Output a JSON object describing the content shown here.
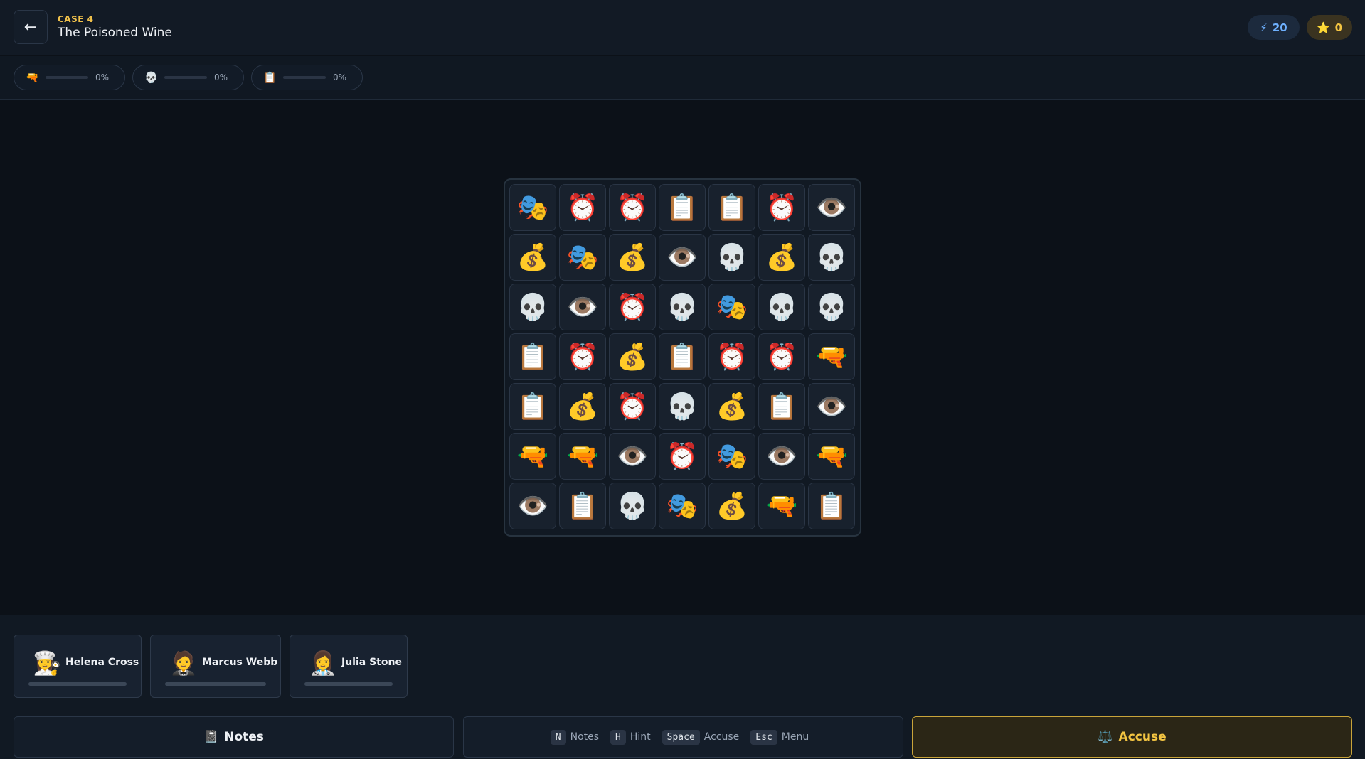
{
  "header": {
    "back_icon": "←",
    "case_label": "CASE 4",
    "title": "The Poisoned Wine",
    "energy": {
      "icon": "⚡",
      "value": "20"
    },
    "stars": {
      "icon": "⭐",
      "value": "0"
    }
  },
  "progress": [
    {
      "icon": "🔫",
      "percent": "0%"
    },
    {
      "icon": "💀",
      "percent": "0%"
    },
    {
      "icon": "📋",
      "percent": "0%"
    }
  ],
  "board": {
    "rows": [
      [
        "🎭",
        "⏰",
        "⏰",
        "📋",
        "📋",
        "⏰",
        "👁️"
      ],
      [
        "💰",
        "🎭",
        "💰",
        "👁️",
        "💀",
        "💰",
        "💀"
      ],
      [
        "💀",
        "👁️",
        "⏰",
        "💀",
        "🎭",
        "💀",
        "💀"
      ],
      [
        "📋",
        "⏰",
        "💰",
        "📋",
        "⏰",
        "⏰",
        "🔫"
      ],
      [
        "📋",
        "💰",
        "⏰",
        "💀",
        "💰",
        "📋",
        "👁️"
      ],
      [
        "🔫",
        "🔫",
        "👁️",
        "⏰",
        "🎭",
        "👁️",
        "🔫"
      ],
      [
        "👁️",
        "📋",
        "💀",
        "🎭",
        "💰",
        "🔫",
        "📋"
      ]
    ]
  },
  "suspects": [
    {
      "avatar": "👩‍🍳",
      "name": "Helena Cross"
    },
    {
      "avatar": "🤵",
      "name": "Marcus Webb"
    },
    {
      "avatar": "👩‍⚕️",
      "name": "Julia Stone"
    }
  ],
  "actions": {
    "notes_icon": "📓",
    "notes_label": "Notes",
    "accuse_icon": "⚖️",
    "accuse_label": "Accuse",
    "shortcuts": [
      {
        "key": "N",
        "label": "Notes"
      },
      {
        "key": "H",
        "label": "Hint"
      },
      {
        "key": "Space",
        "label": "Accuse"
      },
      {
        "key": "Esc",
        "label": "Menu"
      }
    ]
  }
}
